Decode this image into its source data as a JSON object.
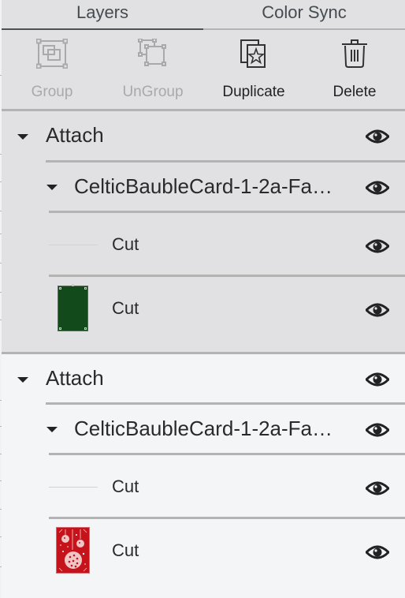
{
  "tabs": [
    {
      "label": "Layers",
      "active": true
    },
    {
      "label": "Color Sync",
      "active": false
    }
  ],
  "toolbar": {
    "group": {
      "label": "Group",
      "icon": "group-icon",
      "enabled": false
    },
    "ungroup": {
      "label": "UnGroup",
      "icon": "ungroup-icon",
      "enabled": false
    },
    "duplicate": {
      "label": "Duplicate",
      "icon": "duplicate-icon",
      "enabled": true
    },
    "delete": {
      "label": "Delete",
      "icon": "trash-icon",
      "enabled": true
    }
  },
  "colors": {
    "panel_bg": "#e1e1e3",
    "selected_group_bg": "#e1e1e3",
    "group_bg": "#f4f5f7",
    "separator": "#b3b3b3",
    "active_tab_underline": "#4a5358",
    "disabled_text": "#a9a9a9",
    "layer1_color": "#124a1c",
    "layer2_color": "#c6121a"
  },
  "layers": [
    {
      "name": "Attach",
      "expanded": true,
      "visible": true,
      "children": [
        {
          "name": "CelticBaubleCard-1-2a-Fa…",
          "expanded": true,
          "visible": true,
          "children": [
            {
              "name": "Cut",
              "thumbnail": "thin-line",
              "visible": true
            },
            {
              "name": "Cut",
              "thumbnail": "green-card",
              "visible": true
            }
          ]
        }
      ]
    },
    {
      "name": "Attach",
      "expanded": true,
      "visible": true,
      "children": [
        {
          "name": "CelticBaubleCard-1-2a-Fa…",
          "expanded": true,
          "visible": true,
          "children": [
            {
              "name": "Cut",
              "thumbnail": "thin-line",
              "visible": true
            },
            {
              "name": "Cut",
              "thumbnail": "red-bauble-card",
              "visible": true
            }
          ]
        }
      ]
    }
  ]
}
